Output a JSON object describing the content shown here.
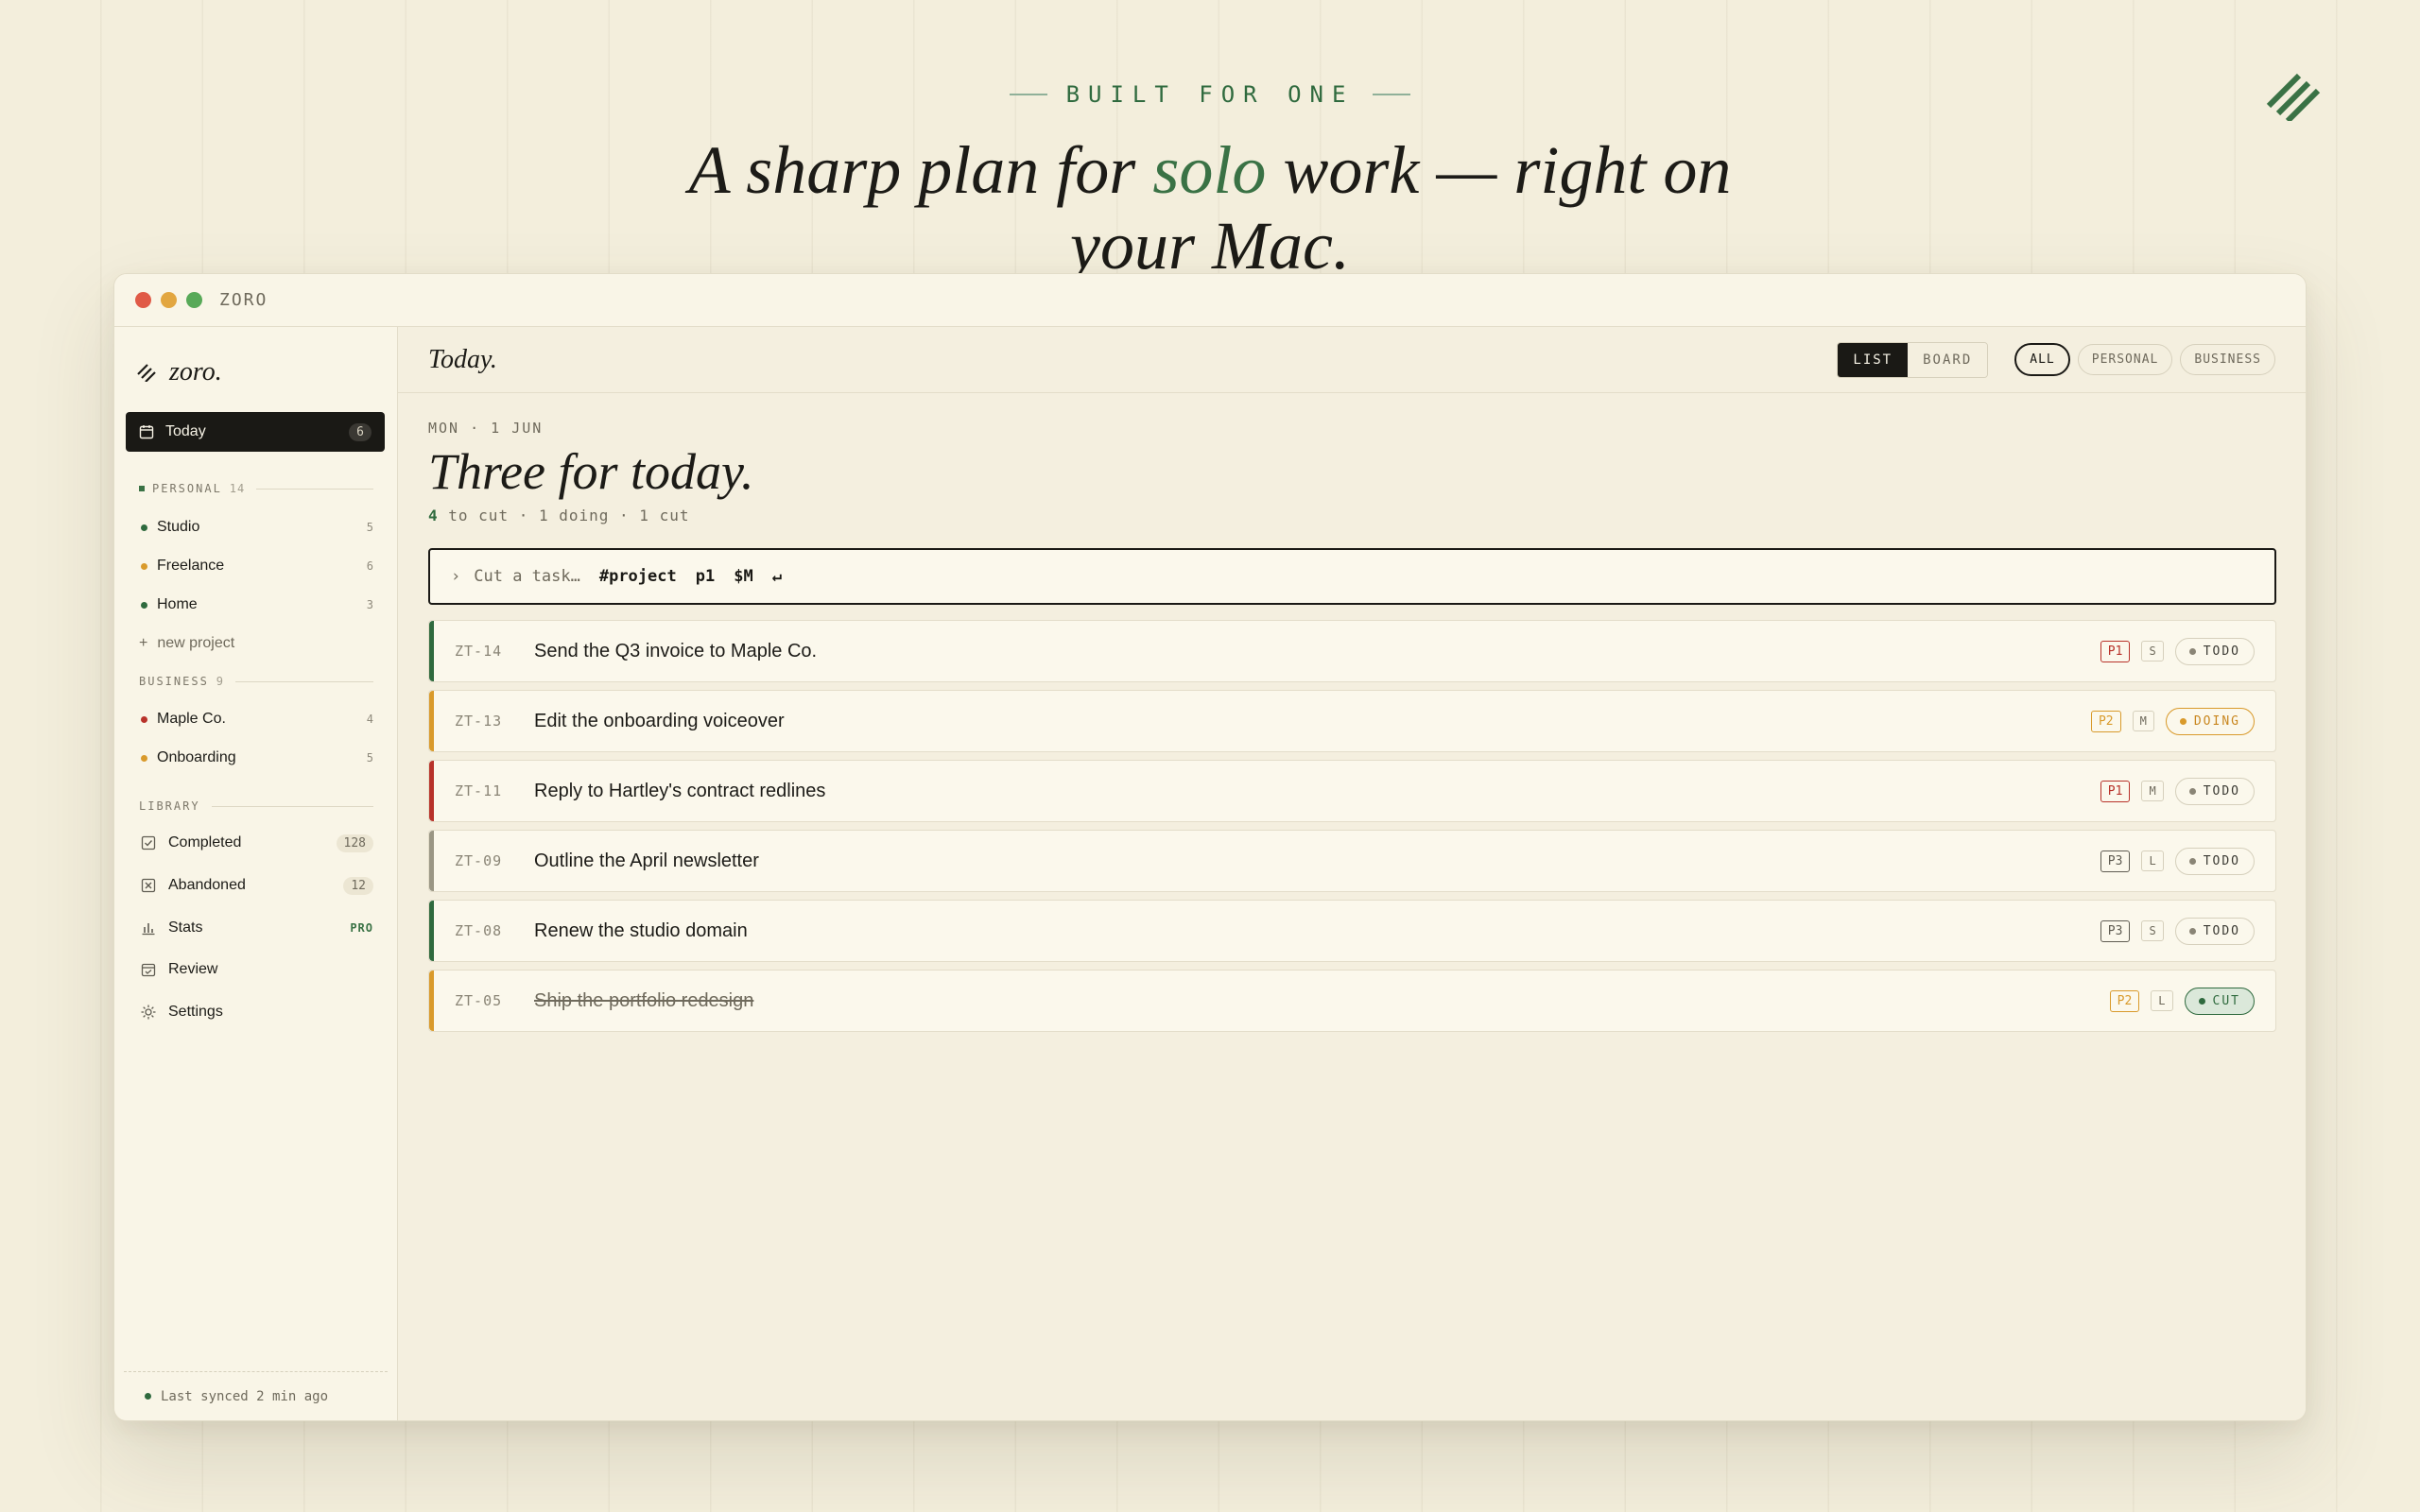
{
  "hero": {
    "eyebrow": "BUILT FOR ONE",
    "title_before": "A sharp plan for ",
    "title_accent": "solo",
    "title_after": " work — right on your Mac."
  },
  "window": {
    "app_name": "ZORO"
  },
  "sidebar": {
    "logo": "zoro.",
    "today": {
      "label": "Today",
      "count": "6"
    },
    "personal": {
      "label": "PERSONAL",
      "count": "14",
      "projects": [
        {
          "name": "Studio",
          "count": "5",
          "color": "#2f6a3e"
        },
        {
          "name": "Freelance",
          "count": "6",
          "color": "#d99a2b"
        },
        {
          "name": "Home",
          "count": "3",
          "color": "#2f6a3e"
        }
      ],
      "new_project": "new project"
    },
    "business": {
      "label": "BUSINESS",
      "count": "9",
      "projects": [
        {
          "name": "Maple Co.",
          "count": "4",
          "color": "#b8322a"
        },
        {
          "name": "Onboarding",
          "count": "5",
          "color": "#d99a2b"
        }
      ]
    },
    "library": {
      "label": "LIBRARY",
      "items": [
        {
          "name": "Completed",
          "count": "128"
        },
        {
          "name": "Abandoned",
          "count": "12"
        },
        {
          "name": "Stats",
          "badge": "PRO"
        },
        {
          "name": "Review"
        },
        {
          "name": "Settings"
        }
      ]
    },
    "sync": "Last synced 2 min ago"
  },
  "main": {
    "title": "Today.",
    "view_toggle": [
      "LIST",
      "BOARD"
    ],
    "filters": [
      "ALL",
      "PERSONAL",
      "BUSINESS"
    ],
    "date": "MON · 1 JUN",
    "heading": "Three for today.",
    "stats": {
      "count": "4",
      "rest": " to cut · 1 doing · 1 cut"
    },
    "quick_add": {
      "placeholder": "Cut a task…",
      "tokens": [
        "#project",
        "p1",
        "$M",
        "↵"
      ]
    },
    "tasks": [
      {
        "id": "ZT-14",
        "title": "Send the Q3 invoice to Maple Co.",
        "priority": "P1",
        "size": "S",
        "status": "TODO",
        "bar_color": "#2f6a3e"
      },
      {
        "id": "ZT-13",
        "title": "Edit the onboarding voiceover",
        "priority": "P2",
        "size": "M",
        "status": "DOING",
        "bar_color": "#d99a2b"
      },
      {
        "id": "ZT-11",
        "title": "Reply to Hartley's contract redlines",
        "priority": "P1",
        "size": "M",
        "status": "TODO",
        "bar_color": "#b8322a"
      },
      {
        "id": "ZT-09",
        "title": "Outline the April newsletter",
        "priority": "P3",
        "size": "L",
        "status": "TODO",
        "bar_color": "#9a9684"
      },
      {
        "id": "ZT-08",
        "title": "Renew the studio domain",
        "priority": "P3",
        "size": "S",
        "status": "TODO",
        "bar_color": "#2f6a3e"
      },
      {
        "id": "ZT-05",
        "title": "Ship the portfolio redesign",
        "priority": "P2",
        "size": "L",
        "status": "CUT",
        "bar_color": "#d99a2b"
      }
    ]
  },
  "colors": {
    "accent": "#3a7245",
    "p1": "#b8322a",
    "p2": "#d99a2b",
    "p3": "#5f5c52",
    "cut_bg": "#dbe8da"
  }
}
